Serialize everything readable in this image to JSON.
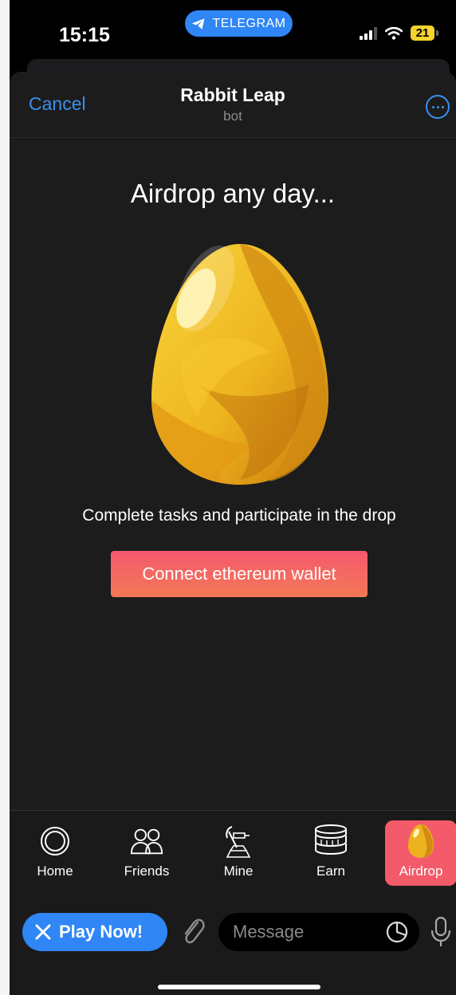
{
  "status_bar": {
    "time": "15:15",
    "app_pill": "TELEGRAM",
    "battery": "21",
    "icons": [
      "signal-icon",
      "wifi-icon",
      "battery-icon"
    ]
  },
  "header": {
    "cancel_label": "Cancel",
    "title": "Rabbit Leap",
    "subtitle": "bot",
    "more_icon": "more-circle-icon"
  },
  "main": {
    "headline": "Airdrop any day...",
    "egg_icon": "golden-egg-icon",
    "description": "Complete tasks and participate in the drop",
    "connect_label": "Connect ethereum wallet"
  },
  "tabs": [
    {
      "label": "Home",
      "icon": "home-circle-icon",
      "active": false
    },
    {
      "label": "Friends",
      "icon": "friends-icon",
      "active": false
    },
    {
      "label": "Mine",
      "icon": "pickaxe-gold-icon",
      "active": false
    },
    {
      "label": "Earn",
      "icon": "coin-stack-icon",
      "active": false
    },
    {
      "label": "Airdrop",
      "icon": "egg-icon",
      "active": true
    }
  ],
  "chat": {
    "play_label": "Play Now!",
    "message_placeholder": "Message",
    "icons": [
      "close-icon",
      "paperclip-icon",
      "sticker-icon",
      "microphone-icon"
    ]
  },
  "colors": {
    "accent_blue": "#2f86f4",
    "link_blue": "#3b8ff0",
    "button_gradient_top": "#f5596d",
    "button_gradient_bottom": "#f37856",
    "active_tab": "#f35b6a",
    "sheet_bg": "#1c1c1c"
  }
}
